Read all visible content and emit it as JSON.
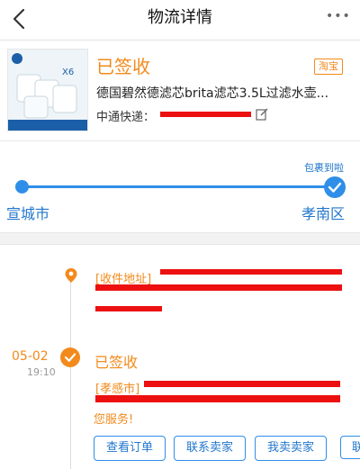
{
  "header": {
    "title": "物流详情",
    "more": "•••"
  },
  "product": {
    "status": "已签收",
    "platform_badge": "淘宝",
    "name": "德国碧然德滤芯brita滤芯3.5L过滤水壶...",
    "courier_label": "中通快递：",
    "thumb_qty": "X6"
  },
  "route": {
    "arrived_note": "包裹到啦",
    "from_city": "宣城市",
    "to_city": "孝南区"
  },
  "timeline": {
    "address_label": "[收件地址]",
    "event_date": "05-02",
    "event_time": "19:10",
    "event_title": "已签收",
    "detail_label": "[孝感市]",
    "detail_end": "您服务!"
  },
  "actions": [
    "查看订单",
    "联系卖家",
    "我卖卖家",
    "联"
  ],
  "colors": {
    "accent_orange": "#f28a1c",
    "accent_blue": "#2f8ee8",
    "redaction": "#ec1010"
  }
}
